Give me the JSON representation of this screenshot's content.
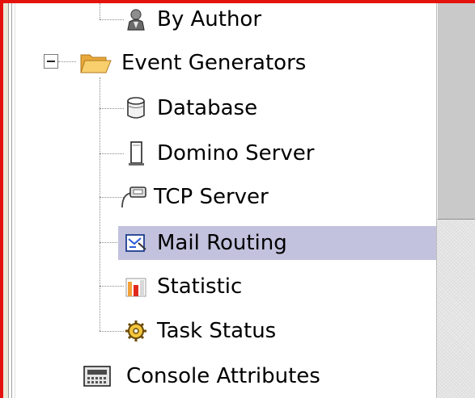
{
  "tree": {
    "items": [
      {
        "label": "By Author",
        "icon": "author-icon",
        "level": 2
      },
      {
        "label": "Event Generators",
        "icon": "folder-open-icon",
        "level": 1,
        "expanded": true
      },
      {
        "label": "Database",
        "icon": "database-icon",
        "level": 2
      },
      {
        "label": "Domino Server",
        "icon": "server-icon",
        "level": 2
      },
      {
        "label": "TCP Server",
        "icon": "network-plug-icon",
        "level": 2
      },
      {
        "label": "Mail Routing",
        "icon": "mail-routing-icon",
        "level": 2,
        "selected": true
      },
      {
        "label": "Statistic",
        "icon": "statistic-chart-icon",
        "level": 2
      },
      {
        "label": "Task Status",
        "icon": "gear-task-icon",
        "level": 2
      },
      {
        "label": "Console Attributes",
        "icon": "console-icon",
        "level": 1
      }
    ]
  },
  "colors": {
    "border_accent": "#e4120c",
    "selection": "#c2c2de",
    "folder": "#f3b64a"
  }
}
